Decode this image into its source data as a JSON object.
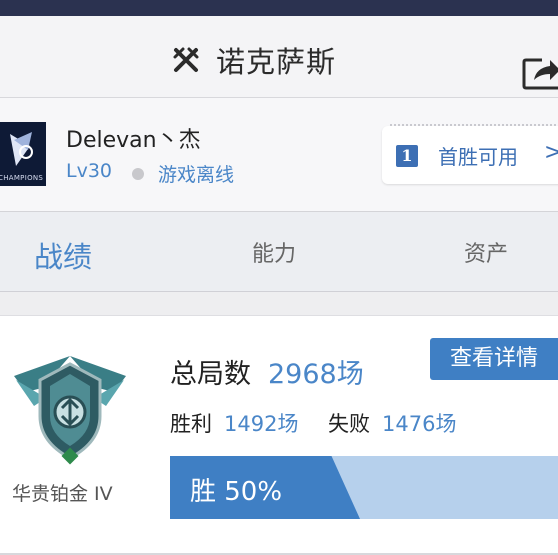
{
  "header": {
    "title": "诺克萨斯",
    "title_icon": "crossed-swords-icon",
    "share_icon": "share-icon"
  },
  "profile": {
    "avatar_label": "CHAMPIONS",
    "nickname": "Delevan丶杰",
    "level": "Lv30",
    "status": "游戏离线",
    "first_win": {
      "badge": "1",
      "label": "首胜可用",
      "arrow": ">"
    }
  },
  "tabs": [
    {
      "label": "战绩",
      "active": true
    },
    {
      "label": "能力",
      "active": false
    },
    {
      "label": "资产",
      "active": false
    }
  ],
  "stats": {
    "rank_name": "华贵铂金 IV",
    "total_label": "总局数",
    "total_value": "2968场",
    "detail_button": "查看详情",
    "wins_label": "胜利",
    "wins_value": "1492场",
    "losses_label": "失败",
    "losses_value": "1476场",
    "win_rate_text": "胜 50%",
    "win_rate": 0.5
  },
  "colors": {
    "accent": "#4a86c8",
    "button": "#3f7fc4",
    "bar_background": "#b6d0ec",
    "top_strip": "#2b3250"
  }
}
